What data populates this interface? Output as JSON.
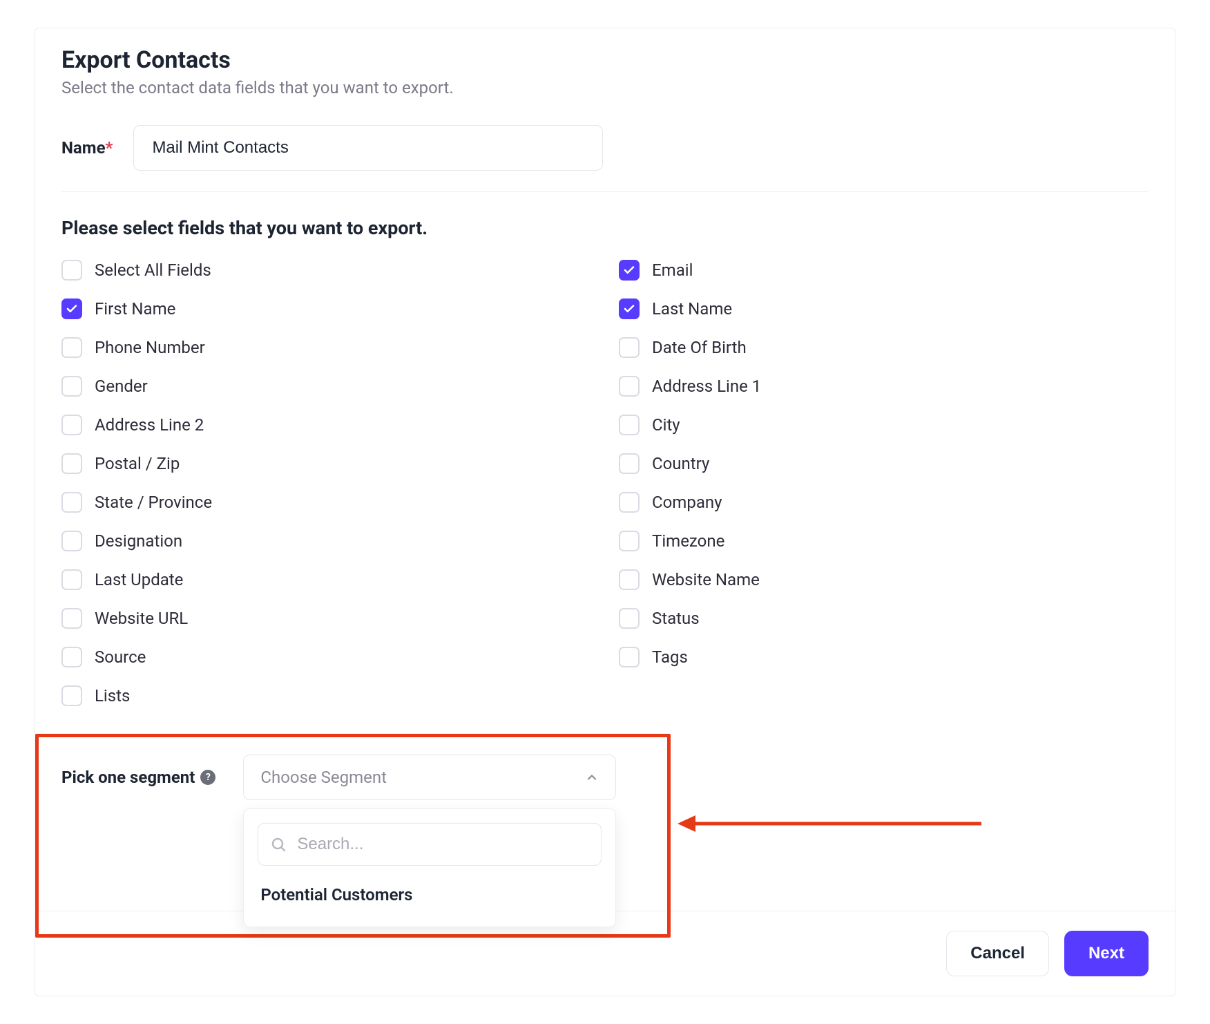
{
  "header": {
    "title": "Export Contacts",
    "subtitle": "Select the contact data fields that you want to export."
  },
  "name": {
    "label": "Name",
    "required_mark": "*",
    "value": "Mail Mint Contacts"
  },
  "fields": {
    "section_title": "Please select fields that you want to export.",
    "items": [
      {
        "label": "Select All Fields",
        "checked": false
      },
      {
        "label": "Email",
        "checked": true
      },
      {
        "label": "First Name",
        "checked": true
      },
      {
        "label": "Last Name",
        "checked": true
      },
      {
        "label": "Phone Number",
        "checked": false
      },
      {
        "label": "Date Of Birth",
        "checked": false
      },
      {
        "label": "Gender",
        "checked": false
      },
      {
        "label": "Address Line 1",
        "checked": false
      },
      {
        "label": "Address Line 2",
        "checked": false
      },
      {
        "label": "City",
        "checked": false
      },
      {
        "label": "Postal / Zip",
        "checked": false
      },
      {
        "label": "Country",
        "checked": false
      },
      {
        "label": "State / Province",
        "checked": false
      },
      {
        "label": "Company",
        "checked": false
      },
      {
        "label": "Designation",
        "checked": false
      },
      {
        "label": "Timezone",
        "checked": false
      },
      {
        "label": "Last Update",
        "checked": false
      },
      {
        "label": "Website Name",
        "checked": false
      },
      {
        "label": "Website URL",
        "checked": false
      },
      {
        "label": "Status",
        "checked": false
      },
      {
        "label": "Source",
        "checked": false
      },
      {
        "label": "Tags",
        "checked": false
      },
      {
        "label": "Lists",
        "checked": false
      }
    ]
  },
  "segment": {
    "label": "Pick one segment",
    "help_glyph": "?",
    "placeholder": "Choose Segment",
    "search_placeholder": "Search...",
    "options": [
      {
        "label": "Potential Customers"
      }
    ]
  },
  "footer": {
    "cancel": "Cancel",
    "next": "Next"
  }
}
